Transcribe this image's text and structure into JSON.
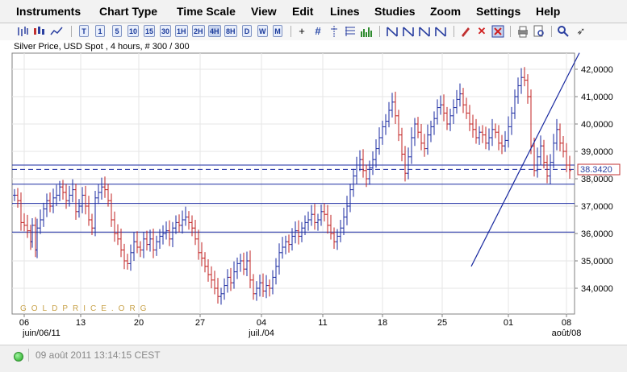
{
  "menu": {
    "items": [
      "Instruments",
      "Chart Type",
      "Time Scale",
      "View",
      "Edit",
      "Lines",
      "Studies",
      "Zoom",
      "Settings",
      "Help"
    ]
  },
  "toolbar": {
    "timeframes": [
      "T",
      "1",
      "5",
      "10",
      "15",
      "30",
      "1H",
      "2H",
      "4H",
      "8H",
      "D",
      "W",
      "M"
    ],
    "icons": [
      "bar-chart-icon",
      "candlestick-icon",
      "line-chart-icon",
      "crosshair-icon",
      "grid-icon",
      "zoom-vertical-icon",
      "volume-icon",
      "fibonacci-icon",
      "trendline-icon",
      "channel-icon",
      "gann-icon",
      "wedge-icon",
      "pencil-icon",
      "delete-icon",
      "delete-all-icon",
      "print-icon",
      "print-preview-icon",
      "zoom-in-icon",
      "pin-icon"
    ]
  },
  "chart": {
    "title": "Silver Price, USD Spot , 4 hours, # 300 / 300",
    "watermark": "GOLDPRICE.ORG",
    "current_price_label": "38.3420"
  },
  "chart_data": {
    "type": "ohlc-bar",
    "ylim": [
      33300,
      42300
    ],
    "y_ticks": [
      "42,0000",
      "41,0000",
      "40,0000",
      "39,0000",
      "38,0000",
      "37,0000",
      "36,0000",
      "35,0000",
      "34,0000"
    ],
    "y_tick_values": [
      42000,
      41000,
      40000,
      39000,
      38000,
      37000,
      36000,
      35000,
      34000
    ],
    "x_ticks": [
      "06",
      "13",
      "20",
      "27",
      "04",
      "11",
      "18",
      "25",
      "01",
      "08"
    ],
    "x_secondary": [
      "juin/06/11",
      "juil./04",
      "août/08"
    ],
    "x_positions": [
      6,
      41,
      77,
      115,
      153,
      191,
      228,
      265,
      306,
      342
    ],
    "horizontal_lines": [
      38500,
      37800,
      37100,
      36050
    ],
    "current_price": 38342,
    "trendline_start": {
      "x": 283,
      "price": 34800
    },
    "trendline_end": {
      "x": 350,
      "price": 42600
    },
    "series": [
      {
        "name": "bars",
        "points": [
          [
            0,
            37400
          ],
          [
            2,
            37200
          ],
          [
            4,
            36400
          ],
          [
            6,
            36300
          ],
          [
            8,
            36100
          ],
          [
            10,
            35700
          ],
          [
            11,
            36300
          ],
          [
            13,
            35400
          ],
          [
            14,
            36200
          ],
          [
            16,
            36500
          ],
          [
            18,
            36900
          ],
          [
            20,
            37200
          ],
          [
            22,
            37000
          ],
          [
            24,
            37300
          ],
          [
            26,
            37400
          ],
          [
            28,
            37700
          ],
          [
            30,
            37500
          ],
          [
            32,
            37200
          ],
          [
            34,
            37400
          ],
          [
            36,
            37600
          ],
          [
            38,
            36800
          ],
          [
            40,
            37000
          ],
          [
            42,
            37400
          ],
          [
            44,
            37000
          ],
          [
            46,
            36500
          ],
          [
            48,
            36200
          ],
          [
            50,
            37300
          ],
          [
            52,
            37500
          ],
          [
            54,
            37700
          ],
          [
            56,
            37600
          ],
          [
            58,
            37200
          ],
          [
            60,
            36500
          ],
          [
            62,
            36000
          ],
          [
            64,
            35800
          ],
          [
            66,
            35400
          ],
          [
            68,
            35000
          ],
          [
            70,
            34900
          ],
          [
            72,
            35300
          ],
          [
            74,
            35700
          ],
          [
            76,
            35500
          ],
          [
            78,
            35400
          ],
          [
            80,
            35800
          ],
          [
            82,
            35600
          ],
          [
            84,
            35800
          ],
          [
            86,
            35400
          ],
          [
            88,
            35700
          ],
          [
            90,
            35900
          ],
          [
            92,
            36000
          ],
          [
            94,
            36100
          ],
          [
            96,
            35800
          ],
          [
            98,
            36200
          ],
          [
            100,
            36400
          ],
          [
            102,
            36300
          ],
          [
            104,
            36500
          ],
          [
            106,
            36600
          ],
          [
            108,
            36400
          ],
          [
            110,
            36200
          ],
          [
            112,
            35800
          ],
          [
            114,
            35300
          ],
          [
            116,
            35100
          ],
          [
            118,
            34800
          ],
          [
            120,
            34500
          ],
          [
            122,
            34300
          ],
          [
            124,
            34000
          ],
          [
            126,
            33700
          ],
          [
            128,
            33800
          ],
          [
            130,
            34100
          ],
          [
            132,
            34400
          ],
          [
            134,
            34200
          ],
          [
            136,
            34600
          ],
          [
            138,
            34900
          ],
          [
            140,
            35000
          ],
          [
            142,
            34700
          ],
          [
            144,
            35000
          ],
          [
            146,
            34300
          ],
          [
            148,
            33800
          ],
          [
            150,
            34000
          ],
          [
            152,
            34200
          ],
          [
            154,
            33900
          ],
          [
            156,
            34100
          ],
          [
            158,
            34000
          ],
          [
            160,
            34400
          ],
          [
            162,
            34800
          ],
          [
            164,
            35300
          ],
          [
            166,
            35500
          ],
          [
            168,
            35700
          ],
          [
            170,
            35600
          ],
          [
            172,
            35900
          ],
          [
            174,
            36100
          ],
          [
            176,
            35900
          ],
          [
            178,
            36200
          ],
          [
            180,
            36400
          ],
          [
            182,
            36500
          ],
          [
            184,
            36700
          ],
          [
            186,
            36400
          ],
          [
            188,
            36500
          ],
          [
            190,
            36800
          ],
          [
            192,
            36700
          ],
          [
            194,
            36300
          ],
          [
            196,
            36000
          ],
          [
            198,
            35700
          ],
          [
            200,
            35900
          ],
          [
            202,
            36200
          ],
          [
            204,
            36600
          ],
          [
            206,
            37000
          ],
          [
            208,
            37600
          ],
          [
            210,
            38100
          ],
          [
            212,
            38500
          ],
          [
            214,
            38700
          ],
          [
            216,
            38300
          ],
          [
            218,
            38000
          ],
          [
            220,
            38400
          ],
          [
            222,
            38700
          ],
          [
            224,
            39100
          ],
          [
            226,
            39500
          ],
          [
            228,
            39900
          ],
          [
            230,
            40100
          ],
          [
            232,
            40500
          ],
          [
            234,
            40800
          ],
          [
            236,
            40300
          ],
          [
            238,
            39600
          ],
          [
            240,
            38900
          ],
          [
            242,
            38200
          ],
          [
            244,
            38800
          ],
          [
            246,
            39500
          ],
          [
            248,
            40000
          ],
          [
            250,
            39700
          ],
          [
            252,
            39300
          ],
          [
            254,
            39100
          ],
          [
            256,
            39600
          ],
          [
            258,
            39900
          ],
          [
            260,
            40200
          ],
          [
            262,
            40600
          ],
          [
            264,
            40700
          ],
          [
            266,
            40400
          ],
          [
            268,
            40000
          ],
          [
            270,
            40300
          ],
          [
            272,
            40600
          ],
          [
            274,
            40900
          ],
          [
            276,
            41100
          ],
          [
            278,
            40700
          ],
          [
            280,
            40400
          ],
          [
            282,
            40000
          ],
          [
            284,
            39800
          ],
          [
            286,
            39500
          ],
          [
            288,
            39700
          ],
          [
            290,
            39600
          ],
          [
            292,
            39300
          ],
          [
            294,
            39500
          ],
          [
            296,
            39800
          ],
          [
            298,
            39700
          ],
          [
            300,
            39300
          ],
          [
            302,
            39200
          ],
          [
            304,
            39400
          ],
          [
            306,
            39900
          ],
          [
            308,
            40400
          ],
          [
            310,
            41000
          ],
          [
            312,
            41400
          ],
          [
            314,
            41700
          ],
          [
            316,
            41600
          ],
          [
            318,
            41000
          ],
          [
            320,
            39200
          ],
          [
            322,
            38300
          ],
          [
            324,
            38800
          ],
          [
            326,
            39200
          ],
          [
            328,
            38600
          ],
          [
            330,
            38100
          ],
          [
            332,
            38600
          ],
          [
            334,
            39300
          ],
          [
            336,
            39800
          ],
          [
            338,
            39300
          ],
          [
            340,
            39000
          ],
          [
            342,
            38500
          ],
          [
            344,
            38300
          ]
        ]
      }
    ]
  },
  "status": {
    "timestamp": "09 août 2011 13:14:15 CEST"
  }
}
